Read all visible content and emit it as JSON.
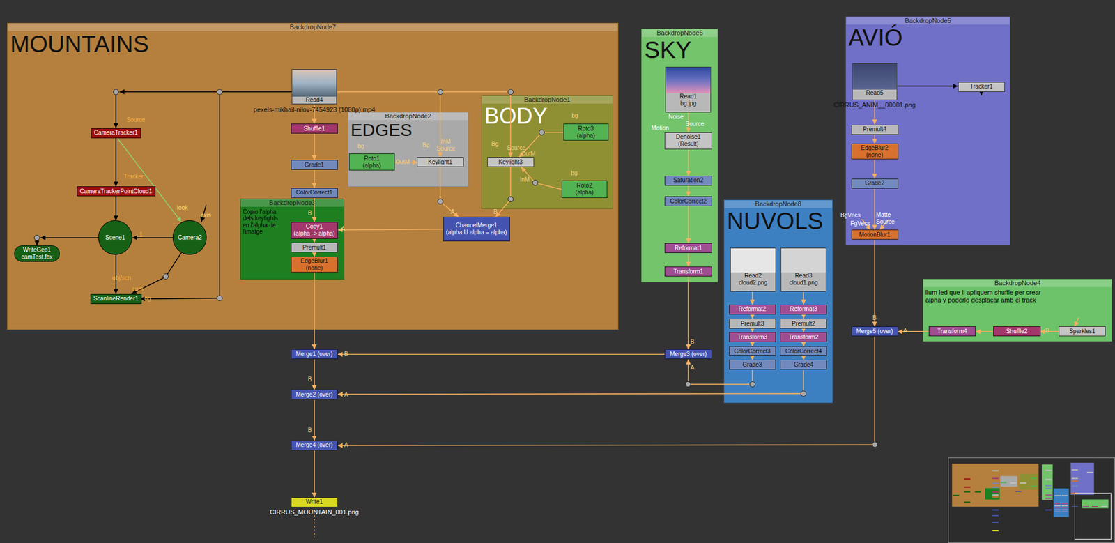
{
  "backdrops": [
    {
      "label": "BackdropNode7",
      "title": "MOUNTAINS",
      "note": "",
      "color": "#b5803e"
    },
    {
      "label": "BackdropNode2",
      "title": "EDGES",
      "note": "",
      "color": "#a9a9a9"
    },
    {
      "label": "BackdropNode1",
      "title": "BODY",
      "note": "",
      "color": "#8f8f33"
    },
    {
      "label": "BackdropNode3",
      "title": "",
      "note": "Copio l'alpha dels keylights en l'alpha de l'imatge",
      "color": "#1d7f20"
    },
    {
      "label": "BackdropNode6",
      "title": "SKY",
      "note": "",
      "color": "#74c46c"
    },
    {
      "label": "BackdropNode8",
      "title": "NUVOLS",
      "note": "",
      "color": "#3d80c2"
    },
    {
      "label": "BackdropNode5",
      "title": "AVIÓ",
      "note": "",
      "color": "#7070c8"
    },
    {
      "label": "BackdropNode4",
      "title": "",
      "note": "llum led que li apliquem shuffle per crear alpha y poderlo desplaçar amb el track",
      "color": "#6cc36a"
    }
  ],
  "nodes": [
    {
      "name": "Read4",
      "sub": "",
      "caption": "pexels-mikhail-nilov-7454923 (1080p).mp4",
      "kind": "read",
      "color": "#b8b8b8"
    },
    {
      "name": "Shuffle1",
      "sub": "",
      "caption": "",
      "kind": "box",
      "color": "#a3376b"
    },
    {
      "name": "Grade1",
      "sub": "",
      "caption": "",
      "kind": "box",
      "color": "#7289bd"
    },
    {
      "name": "ColorCorrect1",
      "sub": "",
      "caption": "",
      "kind": "box",
      "color": "#7289bd"
    },
    {
      "name": "Copy1",
      "sub": "(alpha -> alpha)",
      "caption": "",
      "kind": "box",
      "color": "#a3376b"
    },
    {
      "name": "Premult1",
      "sub": "",
      "caption": "",
      "kind": "box",
      "color": "#b8b8b8"
    },
    {
      "name": "EdgeBlur1",
      "sub": "(none)",
      "caption": "",
      "kind": "box",
      "color": "#d8712f"
    },
    {
      "name": "CameraTracker1",
      "sub": "",
      "caption": "",
      "kind": "box",
      "color": "#9c1111"
    },
    {
      "name": "CameraTrackerPointCloud1",
      "sub": "",
      "caption": "",
      "kind": "box",
      "color": "#9c1111"
    },
    {
      "name": "Scene1",
      "sub": "",
      "caption": "",
      "kind": "circle",
      "color": "#176117"
    },
    {
      "name": "Camera2",
      "sub": "",
      "caption": "",
      "kind": "circle",
      "color": "#176117"
    },
    {
      "name": "WriteGeo1",
      "sub": "camTest.fbx",
      "caption": "",
      "kind": "pill",
      "color": "#176117"
    },
    {
      "name": "ScanlineRender1",
      "sub": "",
      "caption": "",
      "kind": "box",
      "color": "#176117"
    },
    {
      "name": "Roto1",
      "sub": "(alpha)",
      "caption": "",
      "kind": "box",
      "color": "#52b352"
    },
    {
      "name": "Keylight1",
      "sub": "",
      "caption": "",
      "kind": "box",
      "color": "#c4c4c4"
    },
    {
      "name": "Keylight3",
      "sub": "",
      "caption": "",
      "kind": "box",
      "color": "#c4c4c4"
    },
    {
      "name": "Roto3",
      "sub": "(alpha)",
      "caption": "",
      "kind": "box",
      "color": "#52b352"
    },
    {
      "name": "Roto2",
      "sub": "(alpha)",
      "caption": "",
      "kind": "box",
      "color": "#52b352"
    },
    {
      "name": "ChannelMerge1",
      "sub": "(alpha U alpha = alpha)",
      "caption": "",
      "kind": "box",
      "color": "#4453b0"
    },
    {
      "name": "Read1",
      "sub": "bg.jpg",
      "caption": "",
      "kind": "read",
      "color": "#b8b8b8"
    },
    {
      "name": "Denoise1",
      "sub": "(Result)",
      "caption": "",
      "kind": "box",
      "color": "#c4c4c4"
    },
    {
      "name": "Saturation2",
      "sub": "",
      "caption": "",
      "kind": "box",
      "color": "#7289bd"
    },
    {
      "name": "ColorCorrect2",
      "sub": "",
      "caption": "",
      "kind": "box",
      "color": "#7289bd"
    },
    {
      "name": "Reformat1",
      "sub": "",
      "caption": "",
      "kind": "box",
      "color": "#a04e92"
    },
    {
      "name": "Transform1",
      "sub": "",
      "caption": "",
      "kind": "box",
      "color": "#a04e92"
    },
    {
      "name": "Read2",
      "sub": "cloud2.png",
      "caption": "",
      "kind": "read",
      "color": "#b8b8b8"
    },
    {
      "name": "Read3",
      "sub": "cloud1.png",
      "caption": "",
      "kind": "read",
      "color": "#b8b8b8"
    },
    {
      "name": "Reformat2",
      "sub": "",
      "caption": "",
      "kind": "box",
      "color": "#a04e92"
    },
    {
      "name": "Reformat3",
      "sub": "",
      "caption": "",
      "kind": "box",
      "color": "#a04e92"
    },
    {
      "name": "Premult3",
      "sub": "",
      "caption": "",
      "kind": "box",
      "color": "#b8b8b8"
    },
    {
      "name": "Premult2",
      "sub": "",
      "caption": "",
      "kind": "box",
      "color": "#b8b8b8"
    },
    {
      "name": "Transform3",
      "sub": "",
      "caption": "",
      "kind": "box",
      "color": "#a04e92"
    },
    {
      "name": "Transform2",
      "sub": "",
      "caption": "",
      "kind": "box",
      "color": "#a04e92"
    },
    {
      "name": "ColorCorrect3",
      "sub": "",
      "caption": "",
      "kind": "box",
      "color": "#7289bd"
    },
    {
      "name": "ColorCorrect4",
      "sub": "",
      "caption": "",
      "kind": "box",
      "color": "#7289bd"
    },
    {
      "name": "Grade3",
      "sub": "",
      "caption": "",
      "kind": "box",
      "color": "#7289bd"
    },
    {
      "name": "Grade4",
      "sub": "",
      "caption": "",
      "kind": "box",
      "color": "#7289bd"
    },
    {
      "name": "Merge3 (over)",
      "sub": "",
      "caption": "",
      "kind": "box",
      "color": "#4453b0"
    },
    {
      "name": "Merge1 (over)",
      "sub": "",
      "caption": "",
      "kind": "box",
      "color": "#4453b0"
    },
    {
      "name": "Merge2 (over)",
      "sub": "",
      "caption": "",
      "kind": "box",
      "color": "#4453b0"
    },
    {
      "name": "Merge4 (over)",
      "sub": "",
      "caption": "",
      "kind": "box",
      "color": "#4453b0"
    },
    {
      "name": "Write1",
      "sub": "",
      "caption": "CIRRUS_MOUNTAIN_001.png",
      "kind": "box",
      "color": "#d8d81f"
    },
    {
      "name": "Read5",
      "sub": "",
      "caption": "CIRRUS_ANIM__00001.png",
      "kind": "read",
      "color": "#b8b8b8"
    },
    {
      "name": "Tracker1",
      "sub": "",
      "caption": "",
      "kind": "box",
      "color": "#c4c4c4"
    },
    {
      "name": "Premult4",
      "sub": "",
      "caption": "",
      "kind": "box",
      "color": "#b8b8b8"
    },
    {
      "name": "EdgeBlur2",
      "sub": "(none)",
      "caption": "",
      "kind": "box",
      "color": "#d8712f"
    },
    {
      "name": "Grade2",
      "sub": "",
      "caption": "",
      "kind": "box",
      "color": "#7289bd"
    },
    {
      "name": "MotionBlur1",
      "sub": "",
      "caption": "",
      "kind": "box",
      "color": "#d8712f"
    },
    {
      "name": "Merge5 (over)",
      "sub": "",
      "caption": "",
      "kind": "box",
      "color": "#4453b0"
    },
    {
      "name": "Transform4",
      "sub": "",
      "caption": "",
      "kind": "box",
      "color": "#a04e92"
    },
    {
      "name": "Shuffle2",
      "sub": "",
      "caption": "",
      "kind": "box",
      "color": "#a3376b"
    },
    {
      "name": "Sparkles1",
      "sub": "",
      "caption": "",
      "kind": "box",
      "color": "#c4c4c4"
    }
  ],
  "edge_labels": [
    "Source",
    "Tracker",
    "look",
    "axis",
    "1",
    "obj/scn",
    "cam",
    "bg",
    "bg",
    "OutM",
    "Bg",
    "InM",
    "Source",
    "bg",
    "Bg",
    "Source",
    "OutM",
    "InM",
    "bg",
    "A",
    "B",
    "A",
    "B",
    "Noise",
    "Source",
    "Motion",
    "BgVecs",
    "FgVecs",
    "Matte",
    "Source",
    "B",
    "A",
    "A",
    "B",
    "B",
    "B",
    "A",
    "B",
    "A",
    "B"
  ]
}
